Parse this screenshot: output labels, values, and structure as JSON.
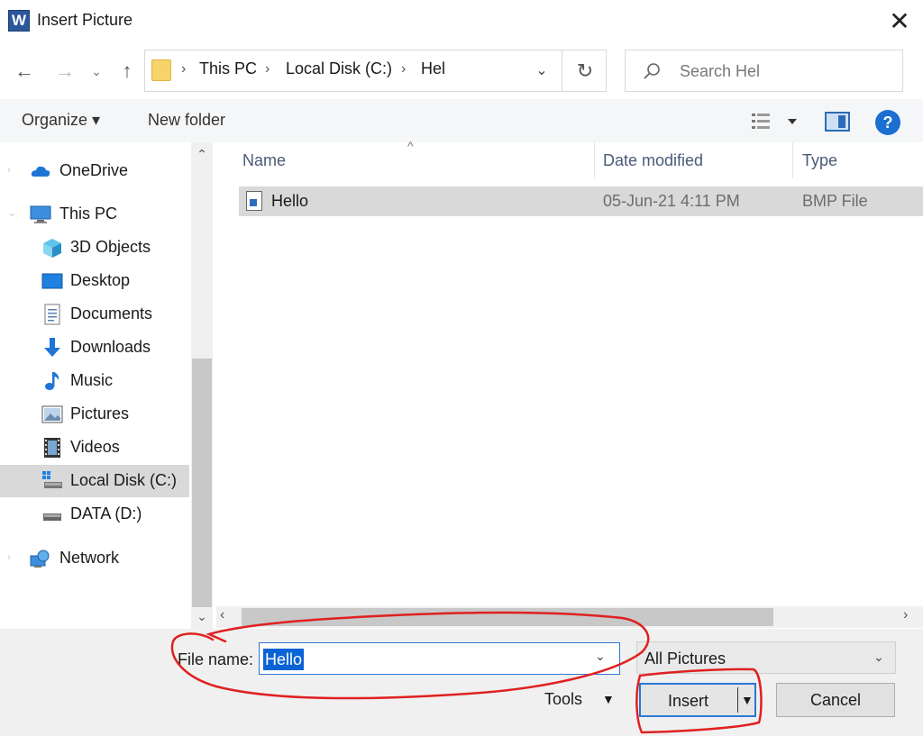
{
  "window": {
    "app_icon": "W",
    "title": "Insert Picture",
    "close_glyph": "✕"
  },
  "nav": {
    "back_glyph": "←",
    "forward_glyph": "→",
    "recent_glyph": "⌄",
    "up_glyph": "↑",
    "breadcrumb": [
      "This PC",
      "Local Disk (C:)",
      "Hel"
    ],
    "crumb_sep": "›",
    "refresh_glyph": "↻",
    "search_placeholder": "Search Hel"
  },
  "toolbar": {
    "organize_label": "Organize ▾",
    "new_folder_label": "New folder",
    "help_label": "?"
  },
  "nav_pane": {
    "items": [
      {
        "label": "OneDrive",
        "icon": "cloud-icon"
      },
      {
        "label": "This PC",
        "icon": "computer-icon"
      },
      {
        "label": "3D Objects",
        "icon": "cube-icon"
      },
      {
        "label": "Desktop",
        "icon": "desktop-icon"
      },
      {
        "label": "Documents",
        "icon": "document-icon"
      },
      {
        "label": "Downloads",
        "icon": "download-icon"
      },
      {
        "label": "Music",
        "icon": "music-icon"
      },
      {
        "label": "Pictures",
        "icon": "picture-icon"
      },
      {
        "label": "Videos",
        "icon": "video-icon"
      },
      {
        "label": "Local Disk (C:)",
        "icon": "drive-icon",
        "selected": true
      },
      {
        "label": "DATA (D:)",
        "icon": "drive-icon"
      },
      {
        "label": "Network",
        "icon": "network-icon"
      }
    ]
  },
  "file_list": {
    "columns": [
      "Name",
      "Date modified",
      "Type"
    ],
    "sort_glyph": "^",
    "rows": [
      {
        "name": "Hello",
        "date": "05-Jun-21 4:11 PM",
        "type": "BMP File",
        "selected": true
      }
    ]
  },
  "bottom": {
    "file_name_label": "File name:",
    "file_name_value": "Hello",
    "file_type": "All Pictures",
    "tools_label": "Tools",
    "insert_label": "Insert",
    "cancel_label": "Cancel"
  },
  "colors": {
    "accent": "#2b78d6",
    "selection": "#0a64d6",
    "annotation": "#e02020"
  }
}
